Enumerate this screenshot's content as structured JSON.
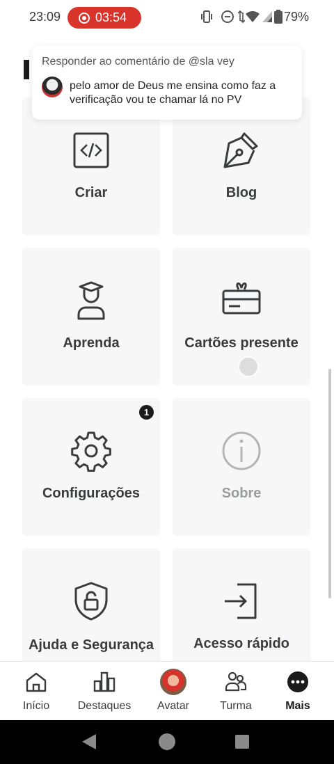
{
  "status_bar": {
    "time": "23:09",
    "recording_time": "03:54",
    "battery": "79%"
  },
  "reply_overlay": {
    "header": "Responder ao comentário de @sla vey",
    "text": "pelo amor de Deus me ensina como faz a verificação vou te chamar lá no PV"
  },
  "tiles": [
    {
      "label": "Criar",
      "icon": "code-icon"
    },
    {
      "label": "Blog",
      "icon": "pen-icon"
    },
    {
      "label": "Aprenda",
      "icon": "graduate-icon"
    },
    {
      "label": "Cartões presente",
      "icon": "gift-card-icon"
    },
    {
      "label": "Configurações",
      "icon": "gear-icon",
      "badge": "1"
    },
    {
      "label": "Sobre",
      "icon": "info-icon"
    },
    {
      "label": "Ajuda e Segurança",
      "icon": "shield-lock-icon"
    },
    {
      "label": "Acesso rápido",
      "icon": "sign-in-icon"
    }
  ],
  "bottom_nav": [
    {
      "label": "Início",
      "icon": "home-icon"
    },
    {
      "label": "Destaques",
      "icon": "charts-icon"
    },
    {
      "label": "Avatar",
      "icon": "avatar-icon"
    },
    {
      "label": "Turma",
      "icon": "people-icon"
    },
    {
      "label": "Mais",
      "icon": "more-icon",
      "active": true
    }
  ],
  "colors": {
    "recording": "#d8342c",
    "tile_bg": "#f7f7f8",
    "text": "#393b3d",
    "dim_text": "#9a9c9e"
  }
}
